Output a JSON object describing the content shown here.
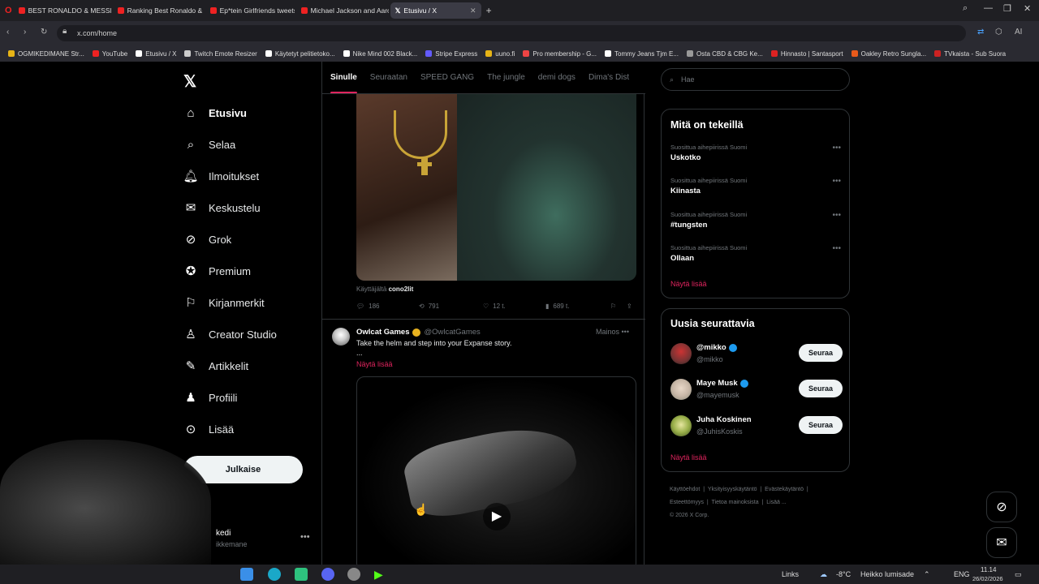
{
  "browser": {
    "tabs": [
      {
        "label": "BEST RONALDO & MESSI ...",
        "active": false
      },
      {
        "label": "Ranking Best Ronaldo & I...",
        "active": false
      },
      {
        "label": "Ep*tein Girlfriends tweets...",
        "active": false
      },
      {
        "label": "Michael Jackson and Aaro...",
        "active": false
      },
      {
        "label": "Etusivu / X",
        "active": true
      }
    ],
    "url": "x.com/home",
    "bookmarks": [
      "OGMIKEDIMANE Str...",
      "YouTube",
      "Etusivu / X",
      "Twitch Emote Resizer",
      "Käytetyt pelitietoko...",
      "Nike Mind 002 Black...",
      "Stripe Express",
      "uuno.fi",
      "Pro membership - G...",
      "Tommy Jeans Tjm E...",
      "Osta CBD & CBG Ke...",
      "Hinnasto | Santasport",
      "Oakley Retro Sungla...",
      "TVkaista - Sub Suora"
    ]
  },
  "nav": {
    "items": [
      "Etusivu",
      "Selaa",
      "Ilmoitukset",
      "Keskustelu",
      "Grok",
      "Premium",
      "Kirjanmerkit",
      "Creator Studio",
      "Artikkelit",
      "Profiili",
      "Lisää"
    ],
    "post_label": "Julkaise",
    "user_name": "kedi",
    "user_handle": "ikkemane"
  },
  "timeline": {
    "tabs": [
      "Sinulle",
      "Seuraatan",
      "SPEED GANG",
      "The jungle",
      "demi dogs",
      "Dima's Dist"
    ],
    "post1": {
      "source_prefix": "Käyttäjältä",
      "source_user": "cono2lit",
      "replies": "186",
      "reposts": "791",
      "likes": "12 t.",
      "views": "689 t."
    },
    "ad": {
      "name": "Owlcat Games",
      "handle": "@OwlcatGames",
      "meta": "Mainos",
      "text": "Take the helm and step into your Expanse story.",
      "dots": "...",
      "more": "Näytä lisää"
    }
  },
  "sidebar": {
    "search_placeholder": "Hae",
    "trends_title": "Mitä on tekeillä",
    "trends": [
      {
        "category": "Suosittua aihepiirissä Suomi",
        "topic": "Uskotko"
      },
      {
        "category": "Suosittua aihepiirissä Suomi",
        "topic": "Kiinasta"
      },
      {
        "category": "Suosittua aihepiirissä Suomi",
        "topic": "#tungsten"
      },
      {
        "category": "Suosittua aihepiirissä Suomi",
        "topic": "Ollaan"
      }
    ],
    "show_more": "Näytä lisää",
    "who_title": "Uusia seurattavia",
    "who": [
      {
        "name": "@mikko",
        "handle": "@mikko",
        "button": "Seuraa"
      },
      {
        "name": "Maye Musk",
        "handle": "@mayemusk",
        "button": "Seuraa"
      },
      {
        "name": "Juha Koskinen",
        "handle": "@JuhisKoskis",
        "button": "Seuraa"
      }
    ],
    "who_more": "Näytä lisää",
    "footer": [
      "Käyttöehdot",
      "Yksityisyyskäytäntö",
      "Evästekäytäntö",
      "Esteettömyys",
      "Tietoa mainoksista",
      "Lisää ...",
      "© 2026 X Corp."
    ]
  },
  "taskbar": {
    "links": "Links",
    "temp": "-8°C",
    "weather": "Heikko lumisade",
    "lang": "ENG",
    "time": "11.14",
    "date": "26/02/2026"
  }
}
